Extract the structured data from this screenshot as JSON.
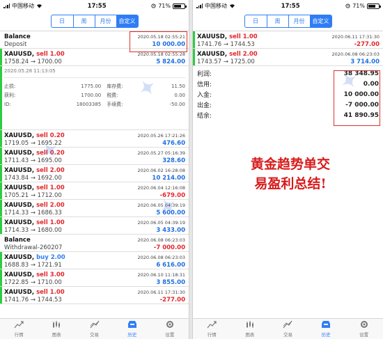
{
  "status": {
    "carrier": "中国移动",
    "time": "17:55",
    "battery": "71%"
  },
  "tabs": [
    "日",
    "周",
    "月份",
    "自定义"
  ],
  "nav": [
    "行情",
    "图表",
    "交易",
    "历史",
    "设置"
  ],
  "left": {
    "balance": {
      "title": "Balance",
      "time": "2020.05.18 02:55:21",
      "label": "Deposit",
      "amount": "10 000.00"
    },
    "trade1": {
      "symbol": "XAUUSD,",
      "side": "sell 1.00",
      "time": "2020.05.18 02:55:28",
      "price": "1758.24 → 1700.00",
      "profit": "5 824.00"
    },
    "detail": {
      "datetime": "2020.05.28 11:13:05",
      "sl_label": "止损:",
      "sl": "1775.00",
      "swap_label": "库存费:",
      "swap": "11.50",
      "tp_label": "获利:",
      "tp": "1700.00",
      "tax_label": "税费:",
      "tax": "0.00",
      "id_label": "ID:",
      "id": "18003385",
      "fee_label": "手续费:",
      "fee": "-50.00"
    },
    "trades": [
      {
        "symbol": "XAUUSD,",
        "side": "sell 0.20",
        "type": "sell",
        "time": "2020.05.26 17:21:26",
        "price": "1719.05 → 1695.22",
        "profit": "476.60",
        "sign": "pos"
      },
      {
        "symbol": "XAUUSD,",
        "side": "sell 0.20",
        "type": "sell",
        "time": "2020.05.27 05:16:39",
        "price": "1711.43 → 1695.00",
        "profit": "328.60",
        "sign": "pos"
      },
      {
        "symbol": "XAUUSD,",
        "side": "sell 2.00",
        "type": "sell",
        "time": "2020.06.02 16:28:08",
        "price": "1743.84 → 1692.00",
        "profit": "10 214.00",
        "sign": "pos"
      },
      {
        "symbol": "XAUUSD,",
        "side": "sell 1.00",
        "type": "sell",
        "time": "2020.06.04 12:16:08",
        "price": "1705.21 → 1712.00",
        "profit": "-679.00",
        "sign": "neg"
      },
      {
        "symbol": "XAUUSD,",
        "side": "sell 2.00",
        "type": "sell",
        "time": "2020.06.05 04:39:19",
        "price": "1714.33 → 1686.33",
        "profit": "5 600.00",
        "sign": "pos"
      },
      {
        "symbol": "XAUUSD,",
        "side": "sell 1.00",
        "type": "sell",
        "time": "2020.06.05 04:39:19",
        "price": "1714.33 → 1680.00",
        "profit": "3 433.00",
        "sign": "pos"
      }
    ],
    "withdrawal": {
      "title": "Balance",
      "time": "2020.06.08 06:23:03",
      "label": "Withdrawal-260207",
      "amount": "-7 000.00"
    },
    "trades2": [
      {
        "symbol": "XAUUSD,",
        "side": "buy 2.00",
        "type": "buy",
        "time": "2020.06.08 06:23:03",
        "price": "1688.83 → 1721.91",
        "profit": "6 616.00",
        "sign": "pos"
      },
      {
        "symbol": "XAUUSD,",
        "side": "sell 3.00",
        "type": "sell",
        "time": "2020.06.10 11:18:31",
        "price": "1722.85 → 1710.00",
        "profit": "3 855.00",
        "sign": "pos"
      },
      {
        "symbol": "XAUUSD,",
        "side": "sell 1.00",
        "type": "sell",
        "time": "2020.06.11 17:31:30",
        "price": "1741.76 → 1744.53",
        "profit": "-277.00",
        "sign": "neg"
      }
    ]
  },
  "right": {
    "trades": [
      {
        "symbol": "XAUUSD,",
        "side": "sell 1.00",
        "type": "sell",
        "time": "2020.06.11 17:31:30",
        "price": "1741.76 → 1744.53",
        "profit": "-277.00",
        "sign": "neg"
      },
      {
        "symbol": "XAUUSD,",
        "side": "sell 2.00",
        "type": "sell",
        "time": "2020.06.08 06:23:03",
        "price": "1743.57 → 1725.00",
        "profit": "3 714.00",
        "sign": "pos"
      }
    ],
    "summary": [
      {
        "label": "利润:",
        "value": "38 348.95"
      },
      {
        "label": "信用:",
        "value": "0.00"
      },
      {
        "label": "入金:",
        "value": "10 000.00"
      },
      {
        "label": "出金:",
        "value": "-7 000.00"
      },
      {
        "label": "结余:",
        "value": "41 890.95"
      }
    ],
    "annotation": [
      "黄金趋势单交",
      "易盈利总结!"
    ]
  }
}
